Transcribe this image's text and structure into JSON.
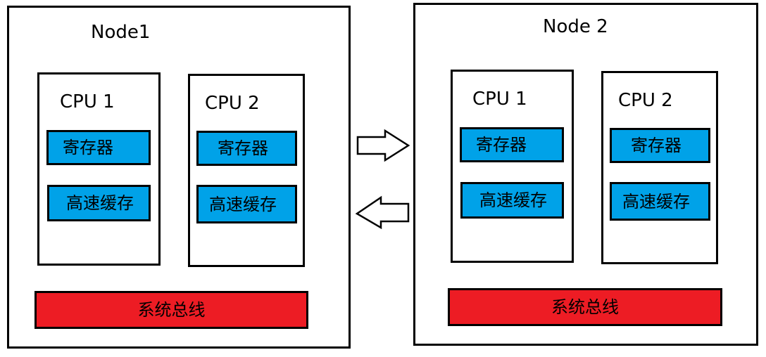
{
  "nodes": [
    {
      "title": "Node1",
      "cpus": [
        {
          "label": "CPU 1",
          "register": "寄存器",
          "cache": "高速缓存"
        },
        {
          "label": "CPU 2",
          "register": "寄存器",
          "cache": "高速缓存"
        }
      ],
      "bus": "系统总线"
    },
    {
      "title": "Node 2",
      "cpus": [
        {
          "label": "CPU 1",
          "register": "寄存器",
          "cache": "高速缓存"
        },
        {
          "label": "CPU 2",
          "register": "寄存器",
          "cache": "高速缓存"
        }
      ],
      "bus": "系统总线"
    }
  ],
  "arrows": [
    {
      "direction": "right",
      "meaning": "Node1 to Node 2"
    },
    {
      "direction": "left",
      "meaning": "Node 2 to Node1"
    }
  ],
  "colors": {
    "component_fill": "#00a2e8",
    "bus_fill": "#ed1c24",
    "outline": "#000000"
  }
}
